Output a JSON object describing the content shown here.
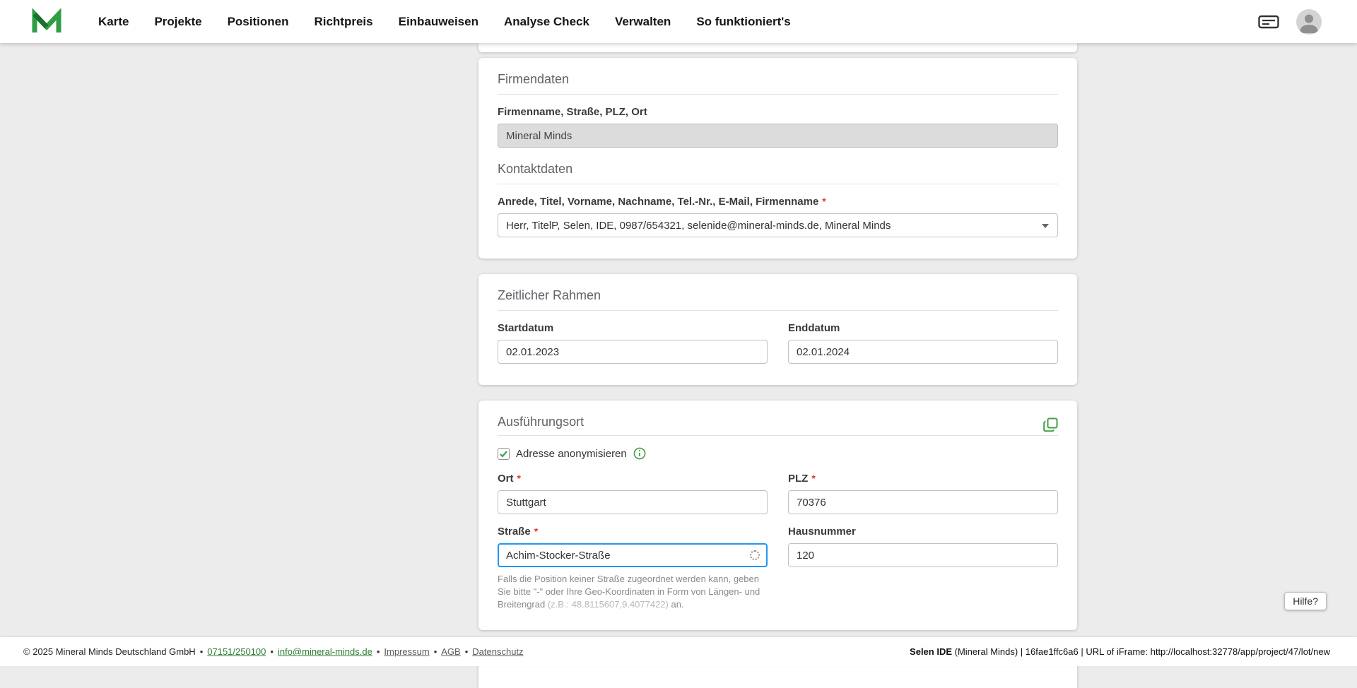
{
  "nav": {
    "items": [
      "Karte",
      "Projekte",
      "Positionen",
      "Richtpreis",
      "Einbauweisen",
      "Analyse Check",
      "Verwalten",
      "So funktioniert's"
    ]
  },
  "ui": {
    "required_marker": "*",
    "help_label": "Hilfe?"
  },
  "firmendaten": {
    "title": "Firmendaten",
    "firmenname_label": "Firmenname, Straße, PLZ, Ort",
    "firmenname_value": "Mineral Minds",
    "kontakt_title": "Kontaktdaten",
    "kontakt_label": "Anrede, Titel, Vorname, Nachname, Tel.-Nr., E-Mail, Firmenname",
    "kontakt_value": "Herr, TitelP, Selen, IDE, 0987/654321, selenide@mineral-minds.de, Mineral Minds"
  },
  "zeitraum": {
    "title": "Zeitlicher Rahmen",
    "start_label": "Startdatum",
    "start_value": "02.01.2023",
    "end_label": "Enddatum",
    "end_value": "02.01.2024"
  },
  "ausfuehrungsort": {
    "title": "Ausführungsort",
    "anonymisieren_label": "Adresse anonymisieren",
    "ort_label": "Ort",
    "ort_value": "Stuttgart",
    "plz_label": "PLZ",
    "plz_value": "70376",
    "strasse_label": "Straße",
    "strasse_value": "Achim-Stocker-Straße",
    "hausnummer_label": "Hausnummer",
    "hausnummer_value": "120",
    "hint_text": "Falls die Position keiner Straße zugeordnet werden kann, geben Sie bitte \"-\" oder Ihre Geo-Koordinaten in Form von Längen- und Breitengrad ",
    "hint_example": "(z.B.: 48.8115607,9.4077422)",
    "hint_suffix": " an."
  },
  "footer": {
    "bullet": "•",
    "copyright": "© 2025 Mineral Minds Deutschland GmbH",
    "phone": "07151/250100",
    "email": "info@mineral-minds.de",
    "links": [
      "Impressum",
      "AGB",
      "Datenschutz"
    ],
    "right_bold": "Selen IDE",
    "right_rest": " (Mineral Minds) | 16fae1ffc6a6 | URL of iFrame: http://localhost:32778/app/project/47/lot/new"
  },
  "colors": {
    "accent_green": "#2f9e44",
    "check_green": "#43a047",
    "focus_blue": "#2196f3",
    "required_red": "#e53935",
    "background": "#ececec"
  }
}
